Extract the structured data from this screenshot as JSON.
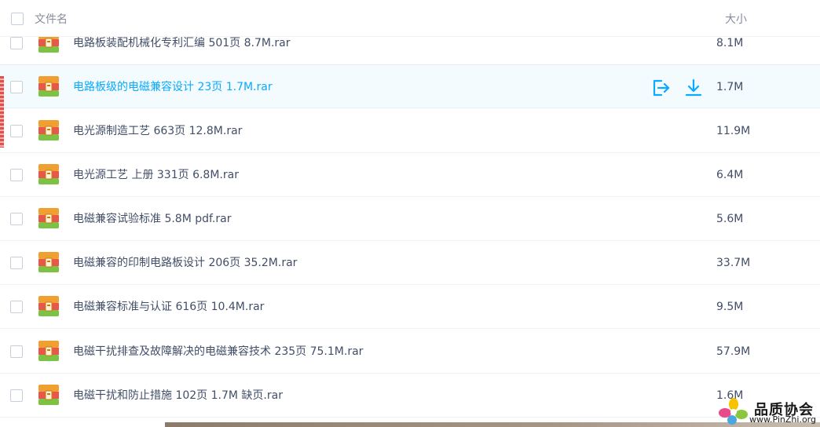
{
  "header": {
    "name_col": "文件名",
    "size_col": "大小"
  },
  "files": [
    {
      "name": "电路板装配机械化专利汇编 501页 8.7M.rar",
      "size": "8.1M"
    },
    {
      "name": "电路板级的电磁兼容设计 23页 1.7M.rar",
      "size": "1.7M"
    },
    {
      "name": "电光源制造工艺 663页 12.8M.rar",
      "size": "11.9M"
    },
    {
      "name": "电光源工艺 上册 331页 6.8M.rar",
      "size": "6.4M"
    },
    {
      "name": "电磁兼容试验标准 5.8M pdf.rar",
      "size": "5.6M"
    },
    {
      "name": "电磁兼容的印制电路板设计 206页 35.2M.rar",
      "size": "33.7M"
    },
    {
      "name": "电磁兼容标准与认证 616页 10.4M.rar",
      "size": "9.5M"
    },
    {
      "name": "电磁干扰排查及故障解决的电磁兼容技术 235页 75.1M.rar",
      "size": "57.9M"
    },
    {
      "name": "电磁干扰和防止措施 102页 1.7M 缺页.rar",
      "size": "1.6M"
    }
  ],
  "selected_index": 1,
  "icons": {
    "file": "archive-file-icon",
    "share": "share-icon",
    "download": "download-icon"
  },
  "colors": {
    "accent": "#09aaff",
    "text": "#424e67",
    "header_text": "#878c9c"
  },
  "watermark": {
    "title": "品质协会",
    "url": "www.PinZhi.org"
  }
}
